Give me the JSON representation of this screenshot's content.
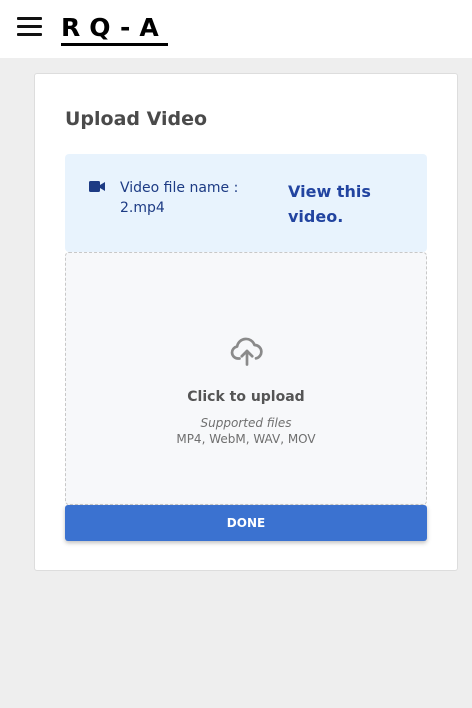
{
  "header": {
    "logo_text": "RQ-A",
    "menu_icon": "hamburger-menu-icon"
  },
  "card": {
    "title": "Upload Video",
    "file": {
      "icon": "video-camera-icon",
      "label": "Video file name : 2.mp4",
      "view_link": "View this video."
    },
    "dropzone": {
      "icon": "cloud-upload-icon",
      "title": "Click to upload",
      "supported_label": "Supported files",
      "formats": "MP4, WebM, WAV, MOV"
    },
    "done_label": "DONE"
  },
  "colors": {
    "accent": "#3b72d0",
    "link": "#2244a0",
    "file_box_bg": "#e8f3fd",
    "page_bg": "#eeeeee"
  }
}
